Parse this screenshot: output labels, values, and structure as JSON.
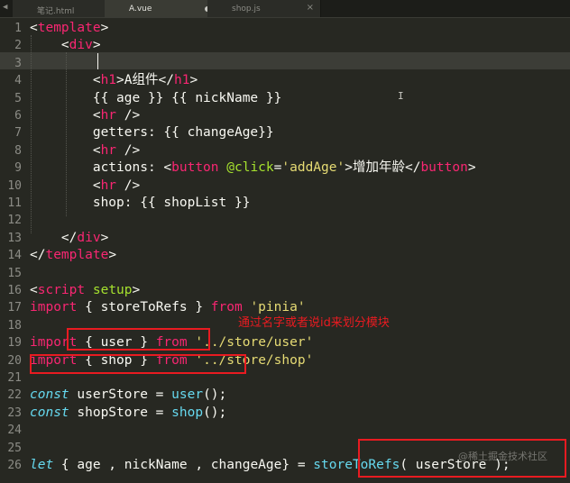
{
  "tabs": [
    {
      "label": "笔记.html",
      "active": false,
      "state": "close"
    },
    {
      "label": "A.vue",
      "active": true,
      "state": "dirty"
    },
    {
      "label": "shop.js",
      "active": false,
      "state": "close"
    }
  ],
  "tab_arrow": "◀",
  "tab_close_glyph": "×",
  "editor": {
    "current_line": 3,
    "lines": [
      {
        "n": "1",
        "t": [
          {
            "c": "tx",
            "v": "<"
          },
          {
            "c": "pk",
            "v": "template"
          },
          {
            "c": "tx",
            "v": ">"
          }
        ]
      },
      {
        "n": "2",
        "t": [
          {
            "c": "tx",
            "v": "    <"
          },
          {
            "c": "pk",
            "v": "div"
          },
          {
            "c": "tx",
            "v": ">"
          }
        ]
      },
      {
        "n": "3",
        "t": []
      },
      {
        "n": "4",
        "t": [
          {
            "c": "tx",
            "v": "        <"
          },
          {
            "c": "pk",
            "v": "h1"
          },
          {
            "c": "tx",
            "v": ">A组件</"
          },
          {
            "c": "pk",
            "v": "h1"
          },
          {
            "c": "tx",
            "v": ">"
          }
        ]
      },
      {
        "n": "5",
        "t": [
          {
            "c": "tx",
            "v": "        {{ age }} {{ nickName }}"
          }
        ]
      },
      {
        "n": "6",
        "t": [
          {
            "c": "tx",
            "v": "        <"
          },
          {
            "c": "pk",
            "v": "hr"
          },
          {
            "c": "tx",
            "v": " />"
          }
        ]
      },
      {
        "n": "7",
        "t": [
          {
            "c": "tx",
            "v": "        getters: {{ changeAge}}"
          }
        ]
      },
      {
        "n": "8",
        "t": [
          {
            "c": "tx",
            "v": "        <"
          },
          {
            "c": "pk",
            "v": "hr"
          },
          {
            "c": "tx",
            "v": " />"
          }
        ]
      },
      {
        "n": "9",
        "t": [
          {
            "c": "tx",
            "v": "        actions: <"
          },
          {
            "c": "pk",
            "v": "button"
          },
          {
            "c": "tx",
            "v": " "
          },
          {
            "c": "ac",
            "v": "@click"
          },
          {
            "c": "tx",
            "v": "="
          },
          {
            "c": "st",
            "v": "'addAge'"
          },
          {
            "c": "tx",
            "v": ">增加年龄</"
          },
          {
            "c": "pk",
            "v": "button"
          },
          {
            "c": "tx",
            "v": ">"
          }
        ]
      },
      {
        "n": "10",
        "t": [
          {
            "c": "tx",
            "v": "        <"
          },
          {
            "c": "pk",
            "v": "hr"
          },
          {
            "c": "tx",
            "v": " />"
          }
        ]
      },
      {
        "n": "11",
        "t": [
          {
            "c": "tx",
            "v": "        shop: {{ shopList }}"
          }
        ]
      },
      {
        "n": "12",
        "t": []
      },
      {
        "n": "13",
        "t": [
          {
            "c": "tx",
            "v": "    </"
          },
          {
            "c": "pk",
            "v": "div"
          },
          {
            "c": "tx",
            "v": ">"
          }
        ]
      },
      {
        "n": "14",
        "t": [
          {
            "c": "tx",
            "v": "</"
          },
          {
            "c": "pk",
            "v": "template"
          },
          {
            "c": "tx",
            "v": ">"
          }
        ]
      },
      {
        "n": "15",
        "t": []
      },
      {
        "n": "16",
        "t": [
          {
            "c": "tx",
            "v": "<"
          },
          {
            "c": "pk",
            "v": "script"
          },
          {
            "c": "tx",
            "v": " "
          },
          {
            "c": "ac",
            "v": "setup"
          },
          {
            "c": "tx",
            "v": ">"
          }
        ]
      },
      {
        "n": "17",
        "t": [
          {
            "c": "kw",
            "v": "import"
          },
          {
            "c": "tx",
            "v": " { storeToRefs } "
          },
          {
            "c": "kw",
            "v": "from"
          },
          {
            "c": "tx",
            "v": " "
          },
          {
            "c": "st",
            "v": "'pinia'"
          }
        ]
      },
      {
        "n": "18",
        "t": []
      },
      {
        "n": "19",
        "t": [
          {
            "c": "kw",
            "v": "import"
          },
          {
            "c": "tx",
            "v": " { user } "
          },
          {
            "c": "kw",
            "v": "from"
          },
          {
            "c": "tx",
            "v": " "
          },
          {
            "c": "st",
            "v": "'../store/user'"
          }
        ]
      },
      {
        "n": "20",
        "t": [
          {
            "c": "kw",
            "v": "import"
          },
          {
            "c": "tx",
            "v": " { shop } "
          },
          {
            "c": "kw",
            "v": "from"
          },
          {
            "c": "tx",
            "v": " "
          },
          {
            "c": "st",
            "v": "'../store/shop'"
          }
        ]
      },
      {
        "n": "21",
        "t": []
      },
      {
        "n": "22",
        "t": [
          {
            "c": "it",
            "v": "const"
          },
          {
            "c": "tx",
            "v": " userStore = "
          },
          {
            "c": "fn",
            "v": "user"
          },
          {
            "c": "tx",
            "v": "();"
          }
        ]
      },
      {
        "n": "23",
        "t": [
          {
            "c": "it",
            "v": "const"
          },
          {
            "c": "tx",
            "v": " shopStore = "
          },
          {
            "c": "fn",
            "v": "shop"
          },
          {
            "c": "tx",
            "v": "();"
          }
        ]
      },
      {
        "n": "24",
        "t": []
      },
      {
        "n": "25",
        "t": []
      },
      {
        "n": "26",
        "t": [
          {
            "c": "it",
            "v": "let"
          },
          {
            "c": "tx",
            "v": " { age , nickName , changeAge} = "
          },
          {
            "c": "fn",
            "v": "storeToRefs"
          },
          {
            "c": "tx",
            "v": "( userStore );"
          }
        ]
      }
    ]
  },
  "annotation": {
    "text": "通过名字或者说id来划分模块",
    "color": "#e81b21"
  },
  "watermark": "@稀土掘金技术社区",
  "colors": {
    "background": "#272822",
    "tag": "#f92672",
    "string": "#e6db74",
    "attribute": "#a6e22e",
    "function": "#66d9ef",
    "plain": "#f8f8f2"
  }
}
